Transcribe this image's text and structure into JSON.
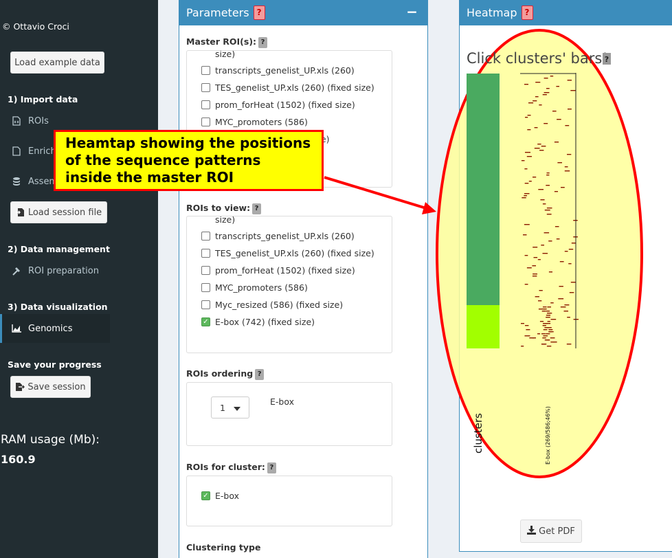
{
  "sidebar": {
    "copyright": "© Ottavio Croci",
    "load_example": "Load example data",
    "import_title": "1) Import data",
    "items": [
      {
        "label": "ROIs",
        "icon": "file-icon"
      },
      {
        "label": "Enrich",
        "icon": "file-blank-icon"
      },
      {
        "label": "Assem",
        "icon": "database-icon"
      }
    ],
    "load_session": "Load session file",
    "management_title": "2) Data management",
    "roi_prep": "ROI preparation",
    "viz_title": "3) Data visualization",
    "genomics": "Genomics",
    "save_progress": "Save your progress",
    "save_session": "Save session",
    "ram_label": "RAM usage (Mb):",
    "ram_value": "160.9"
  },
  "parameters": {
    "title": "Parameters",
    "help": "?",
    "collapse": "−",
    "master_label": "Master ROI(s):",
    "master_size_cut": "size)",
    "master_options": [
      {
        "label": "transcripts_genelist_UP.xls (260)",
        "checked": false
      },
      {
        "label": "TES_genelist_UP.xls (260) (fixed size)",
        "checked": false
      },
      {
        "label": "prom_forHeat (1502) (fixed size)",
        "checked": false
      },
      {
        "label": "MYC_promoters (586)",
        "checked": false
      }
    ],
    "master_fragment": "(e)",
    "view_label": "ROIs to view:",
    "view_size_cut": "size)",
    "view_options": [
      {
        "label": "transcripts_genelist_UP.xls (260)",
        "checked": false
      },
      {
        "label": "TES_genelist_UP.xls (260) (fixed size)",
        "checked": false
      },
      {
        "label": "prom_forHeat (1502) (fixed size)",
        "checked": false
      },
      {
        "label": "MYC_promoters (586)",
        "checked": false
      },
      {
        "label": "Myc_resized (586) (fixed size)",
        "checked": false
      },
      {
        "label": "E-box (742) (fixed size)",
        "checked": true
      }
    ],
    "ordering_label": "ROIs ordering",
    "ordering_value": "1",
    "ordering_name": "E-box",
    "cluster_label": "ROIs for cluster:",
    "cluster_option": {
      "label": "E-box",
      "checked": true
    },
    "clustering_type": "Clustering type"
  },
  "heatmap": {
    "title": "Heatmap",
    "help": "?",
    "click_text": "Click clusters' bars!",
    "cluster_axis": "clusters",
    "column_label": "E-box (269/586;46%)",
    "get_pdf": "Get PDF",
    "cluster_colors": [
      "#1a8a8a",
      "#4aaa60",
      "#a2ff00"
    ],
    "tick_color": "#8b1a00"
  },
  "annotation": {
    "callout_text": "Heamtap showing the positions of the sequence patterns inside the master ROI",
    "callout_bg": "#ffff00",
    "callout_border": "#ff0000",
    "ellipse_fill": "#ffff99",
    "ellipse_stroke": "#ff0000"
  }
}
